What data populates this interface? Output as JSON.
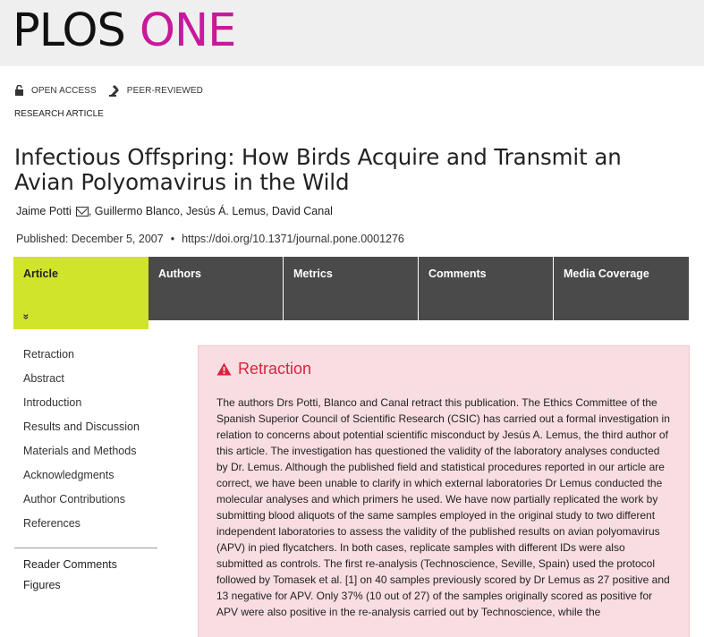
{
  "header": {
    "logo_part1": "PLOS",
    "logo_part2": "ONE",
    "brand_color": "#c8199b"
  },
  "badges": [
    {
      "icon": "lock-open-icon",
      "label": "OPEN ACCESS"
    },
    {
      "icon": "peer-review-icon",
      "label": "PEER-REVIEWED"
    }
  ],
  "article": {
    "type": "RESEARCH ARTICLE",
    "title": "Infectious Offspring: How Birds Acquire and Transmit an Avian Polyomavirus in the Wild",
    "authors": [
      "Jaime Potti",
      "Guillermo Blanco",
      "Jesús Á. Lemus",
      "David Canal"
    ],
    "published": "Published: December 5, 2007",
    "doi": "https://doi.org/10.1371/journal.pone.0001276"
  },
  "tabs": [
    {
      "label": "Article",
      "active": true
    },
    {
      "label": "Authors"
    },
    {
      "label": "Metrics"
    },
    {
      "label": "Comments"
    },
    {
      "label": "Media Coverage"
    }
  ],
  "tab_chevron": "»",
  "sidebar": {
    "items": [
      "Retraction",
      "Abstract",
      "Introduction",
      "Results and Discussion",
      "Materials and Methods",
      "Acknowledgments",
      "Author Contributions",
      "References"
    ],
    "extra": [
      "Reader Comments",
      "Figures"
    ]
  },
  "retraction": {
    "title": "Retraction",
    "body": "The authors Drs Potti, Blanco and Canal retract this publication. The Ethics Committee of the Spanish Superior Council of Scientific Research (CSIC) has carried out a formal investigation in relation to concerns about potential scientific misconduct by Jesús A. Lemus, the third author of this article. The investigation has questioned the validity of the laboratory analyses conducted by Dr. Lemus. Although the published field and statistical procedures reported in our article are correct, we have been unable to clarify in which external laboratories Dr Lemus conducted the molecular analyses and which primers he used. We have now partially replicated the work by submitting blood aliquots of the same samples employed in the original study to two different independent laboratories to assess the validity of the published results on avian polyomavirus (APV) in pied flycatchers. In both cases, replicate samples with different IDs were also submitted as controls. The first re-analysis (Technoscience, Seville, Spain) used the protocol followed by Tomasek et al. [1] on 40 samples previously scored by Dr Lemus as 27 positive and 13 negative for APV. Only 37% (10 out of 27) of the samples originally scored as positive for APV were also positive in the re-analysis carried out by Technoscience, while the",
    "accent_color": "#d8243d",
    "bg_color": "#f8dde2"
  }
}
